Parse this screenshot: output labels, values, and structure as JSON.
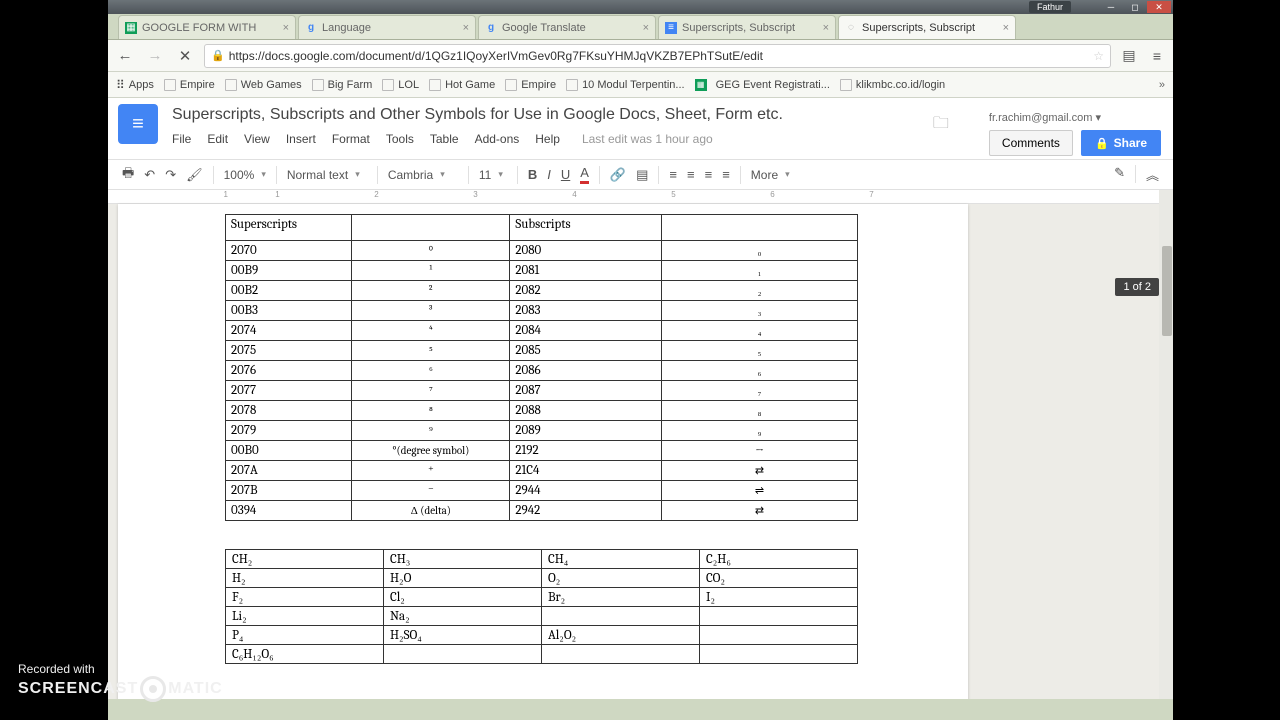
{
  "os": {
    "user": "Fathur"
  },
  "tabs": [
    {
      "label": "GOOGLE FORM WITH",
      "icon": "sheets",
      "color": "#0f9d58"
    },
    {
      "label": "Language",
      "icon": "g",
      "color": "#4285f4"
    },
    {
      "label": "Google Translate",
      "icon": "g",
      "color": "#4285f4"
    },
    {
      "label": "Superscripts, Subscript",
      "icon": "docs",
      "color": "#4285f4"
    },
    {
      "label": "Superscripts, Subscript",
      "icon": "loading",
      "color": "#999",
      "active": true
    }
  ],
  "url": "https://docs.google.com/document/d/1QGz1IQoyXerIVmGev0Rg7FKsuYHMJqVKZB7EPhTSutE/edit",
  "bookmarks": [
    "Apps",
    "Empire",
    "Web Games",
    "Big Farm",
    "LOL",
    "Hot Game",
    "Empire",
    "10 Modul Terpentin...",
    "GEG Event Registrati...",
    "klikmbc.co.id/login"
  ],
  "doc": {
    "title": "Superscripts, Subscripts and Other Symbols for Use in Google Docs, Sheet, Form etc.",
    "menus": [
      "File",
      "Edit",
      "View",
      "Insert",
      "Format",
      "Tools",
      "Table",
      "Add-ons",
      "Help"
    ],
    "last_edit": "Last edit was 1 hour ago",
    "email": "fr.rachim@gmail.com",
    "comments": "Comments",
    "share": "Share"
  },
  "toolbar": {
    "zoom": "100%",
    "style": "Normal text",
    "font": "Cambria",
    "size": "11",
    "more": "More"
  },
  "ruler": [
    "1",
    "2",
    "3",
    "4",
    "5",
    "6",
    "7"
  ],
  "page_indicator": "1 of 2",
  "table1": {
    "h1": "Superscripts",
    "h2": "Subscripts",
    "rows": [
      [
        "2070",
        "⁰",
        "2080",
        "₀"
      ],
      [
        "00B9",
        "¹",
        "2081",
        "₁"
      ],
      [
        "00B2",
        "²",
        "2082",
        "₂"
      ],
      [
        "00B3",
        "³",
        "2083",
        "₃"
      ],
      [
        "2074",
        "⁴",
        "2084",
        "₄"
      ],
      [
        "2075",
        "⁵",
        "2085",
        "₅"
      ],
      [
        "2076",
        "⁶",
        "2086",
        "₆"
      ],
      [
        "2077",
        "⁷",
        "2087",
        "₇"
      ],
      [
        "2078",
        "⁸",
        "2088",
        "₈"
      ],
      [
        "2079",
        "⁹",
        "2089",
        "₉"
      ],
      [
        "00B0",
        "°(degree symbol)",
        "2192",
        "→"
      ],
      [
        "207A",
        "⁺",
        "21C4",
        "⇄"
      ],
      [
        "207B",
        "⁻",
        "2944",
        "⇌"
      ],
      [
        "0394",
        "Δ (delta)",
        "2942",
        "⇄"
      ]
    ]
  },
  "table2": {
    "rows": [
      [
        "CH₂",
        "CH₃",
        "CH₄",
        "C₂H₆"
      ],
      [
        "H₂",
        "H₂O",
        "O₂",
        "CO₂"
      ],
      [
        "F₂",
        "Cl₂",
        "Br₂",
        "I₂"
      ],
      [
        "Li₂",
        "Na₂",
        "",
        ""
      ],
      [
        "P₄",
        "H₂SO₄",
        "Al₂O₂",
        ""
      ],
      [
        "C₆H₁₂O₆",
        "",
        "",
        ""
      ]
    ]
  },
  "watermark": {
    "line1": "Recorded with",
    "line2a": "SCREENCAST",
    "line2b": "MATIC"
  }
}
